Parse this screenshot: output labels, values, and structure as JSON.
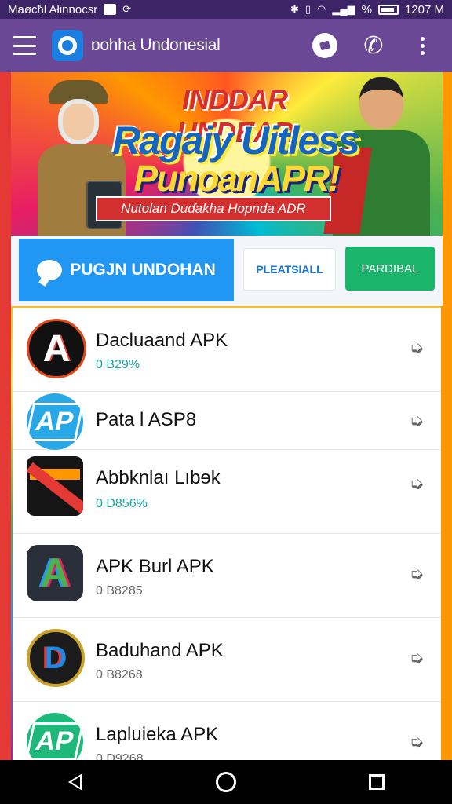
{
  "status_bar": {
    "carrier": "Maøcħl Ałinnocsr",
    "time": "1207 M",
    "battery_label": "%"
  },
  "app_bar": {
    "title": "ɒohha Undonesial"
  },
  "banner": {
    "line1": "INDDAR UNDEAR",
    "line2": "Ragajy Uitless",
    "line3": "PunoanAPR!",
    "ribbon": "Nutolan Duɗakha Hopnda ADR"
  },
  "tabs": {
    "primary": "PUGJN UNDOHAN",
    "secondary": "PLEATSIALL",
    "accent": "PARDIBAL"
  },
  "apps": [
    {
      "title": "Dacluaand APK",
      "subtitle": "0 B29%",
      "icon": "red-a-emblem-icon"
    },
    {
      "title": "Pata l ASP8",
      "subtitle": "",
      "icon": "blue-ap-icon"
    },
    {
      "title": "Abbknlaı Lıbɘk",
      "subtitle": "0 D856%",
      "icon": "red-x-tile-icon"
    },
    {
      "title": "APK Burl APK",
      "subtitle": "0 B8285",
      "icon": "colorful-a-icon"
    },
    {
      "title": "Baduhand APK",
      "subtitle": "0 B8268",
      "icon": "gold-badge-icon"
    },
    {
      "title": "Lapluieka APK",
      "subtitle": "0 D9268",
      "icon": "green-ap-icon"
    }
  ],
  "colors": {
    "status_bar": "#3d2466",
    "app_bar": "#6a4896",
    "primary_tab": "#2196f3",
    "accent_tab": "#19b56a"
  }
}
